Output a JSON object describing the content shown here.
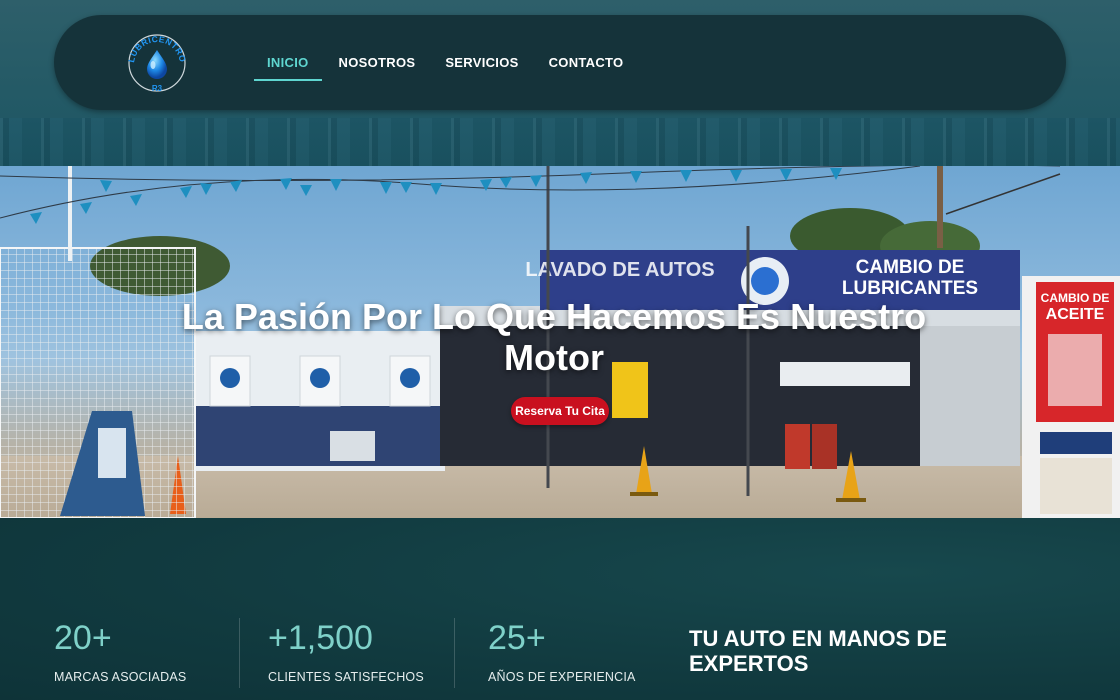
{
  "brand": {
    "logo_text": "LUBRICENTRO",
    "logo_mark": "R3",
    "accent": "#5fd6d0",
    "nav_bg": "#15333a",
    "cta_color": "#c9101f"
  },
  "nav": {
    "items": [
      {
        "label": "INICIO",
        "active": true
      },
      {
        "label": "NOSOTROS",
        "active": false
      },
      {
        "label": "SERVICIOS",
        "active": false
      },
      {
        "label": "CONTACTO",
        "active": false
      }
    ]
  },
  "hero": {
    "title": "La Pasión Por Lo Que Hacemos Es Nuestro Motor",
    "cta_label": "Reserva Tu Cita",
    "sign_left": "LAVADO DE AUTOS",
    "sign_right_1": "CAMBIO DE",
    "sign_right_2": "LUBRICANTES",
    "side_sign_1": "CAMBIO DE",
    "side_sign_2": "ACEITE"
  },
  "stats": [
    {
      "value": "20+",
      "label": "MARCAS ASOCIADAS"
    },
    {
      "value": "+1,500",
      "label": "CLIENTES SATISFECHOS"
    },
    {
      "value": "25+",
      "label": "AÑOS DE EXPERIENCIA"
    }
  ],
  "tagline": "TU AUTO EN MANOS DE EXPERTOS"
}
